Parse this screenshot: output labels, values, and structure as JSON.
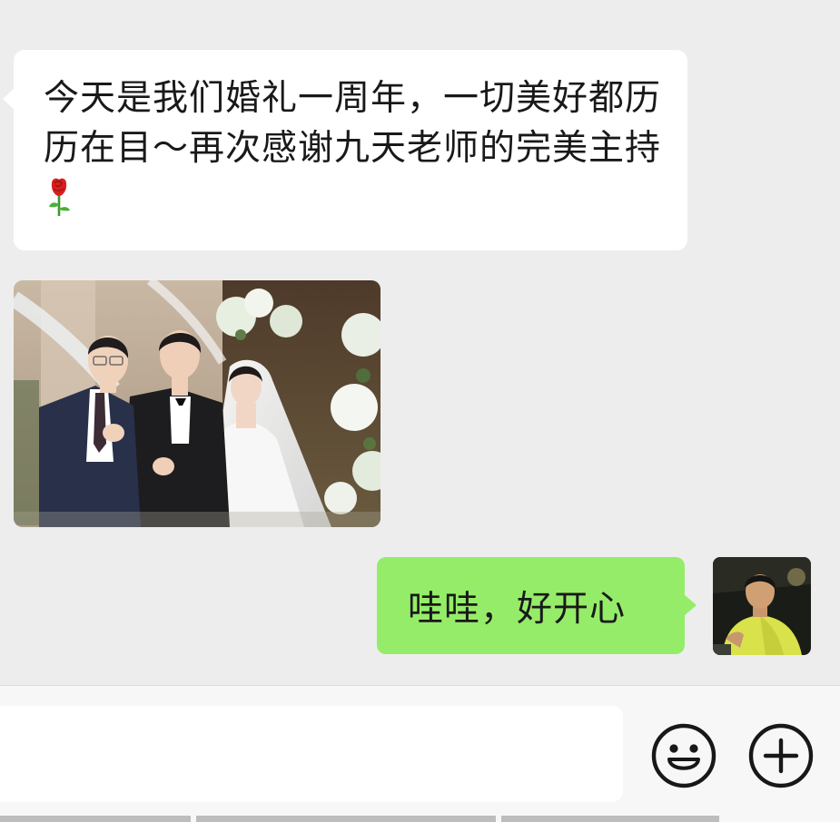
{
  "chat": {
    "incoming_message": {
      "text": "今天是我们婚礼一周年，一切美好都历历在目～再次感谢九天老师的完美主持",
      "emoji": "rose"
    },
    "incoming_photo": {
      "kind": "wedding-photo"
    },
    "outgoing_message": {
      "text": "哇哇，好开心"
    }
  },
  "input_bar": {
    "message_value": "",
    "emoji_button": "smiley-icon",
    "more_button": "plus-circle-icon"
  },
  "colors": {
    "background": "#ededed",
    "incoming_bubble": "#ffffff",
    "outgoing_bubble": "#95ec69",
    "text": "#191919"
  }
}
